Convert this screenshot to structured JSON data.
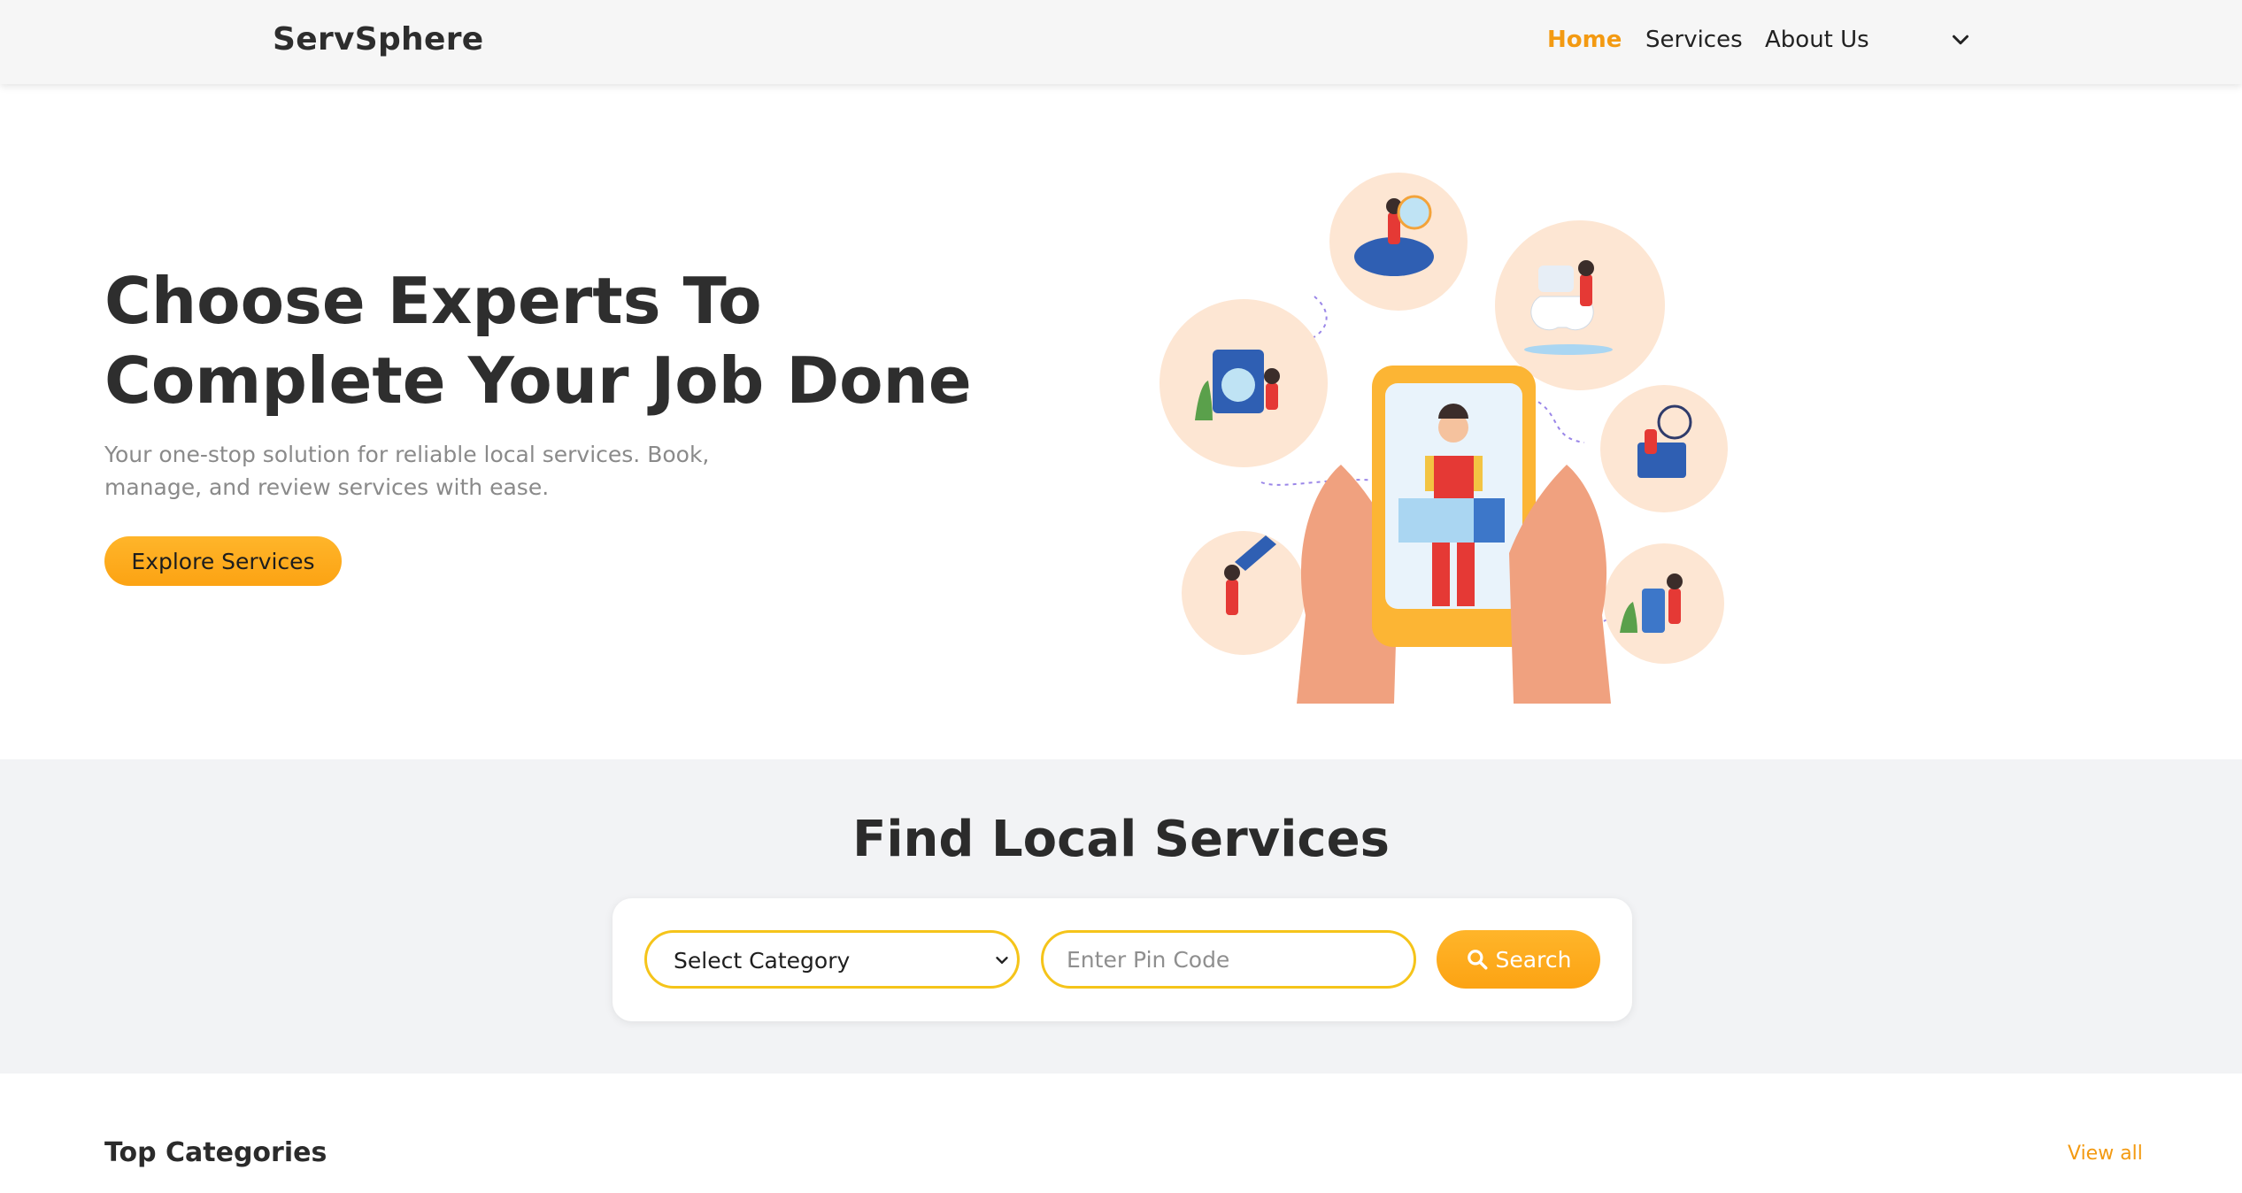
{
  "header": {
    "brand": "ServSphere",
    "nav": {
      "home": "Home",
      "services": "Services",
      "about": "About Us"
    }
  },
  "hero": {
    "title": "Choose Experts To Complete Your Job Done",
    "subtitle": "Your one-stop solution for reliable local services. Book, manage, and review services with ease.",
    "cta": "Explore Services"
  },
  "find": {
    "title": "Find Local Services",
    "category_selected": "Select Category",
    "pin_placeholder": "Enter Pin Code",
    "search_label": "Search"
  },
  "categories": {
    "title": "Top Categories",
    "view_all": "View all"
  },
  "colors": {
    "accent": "#f39a12",
    "button": "#fca313",
    "input_border": "#f5c41a",
    "peach": "#fde6d3",
    "section_bg": "#f2f3f5"
  },
  "icons": [
    "chevron-down-icon",
    "search-icon"
  ]
}
